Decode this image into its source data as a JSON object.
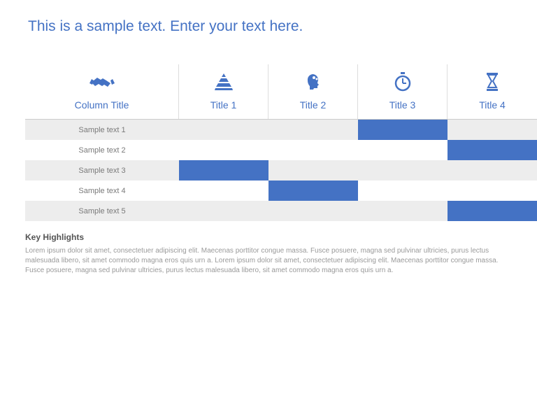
{
  "slide": {
    "title": "This is a sample text. Enter your text here."
  },
  "table": {
    "columns": [
      {
        "label": "Column Title",
        "icon": "handshake"
      },
      {
        "label": "Title 1",
        "icon": "pyramid"
      },
      {
        "label": "Title 2",
        "icon": "head"
      },
      {
        "label": "Title 3",
        "icon": "stopwatch"
      },
      {
        "label": "Title 4",
        "icon": "hourglass"
      }
    ],
    "rows": [
      {
        "label": "Sample text 1",
        "filled": [
          false,
          false,
          true,
          false
        ]
      },
      {
        "label": "Sample text 2",
        "filled": [
          false,
          false,
          false,
          true
        ]
      },
      {
        "label": "Sample text 3",
        "filled": [
          true,
          false,
          false,
          false
        ]
      },
      {
        "label": "Sample text 4",
        "filled": [
          false,
          true,
          false,
          false
        ]
      },
      {
        "label": "Sample text 5",
        "filled": [
          false,
          false,
          false,
          true
        ]
      }
    ]
  },
  "highlights": {
    "title": "Key Highlights",
    "body": "Lorem ipsum dolor sit amet, consectetuer adipiscing elit. Maecenas porttitor congue massa. Fusce posuere, magna sed pulvinar ultricies, purus lectus malesuada libero, sit amet commodo magna eros quis urn a. Lorem ipsum dolor sit amet, consectetuer adipiscing elit. Maecenas porttitor congue massa. Fusce posuere, magna sed pulvinar ultricies, purus lectus malesuada libero, sit amet commodo magna eros quis urn a."
  },
  "colors": {
    "accent": "#4472c4"
  }
}
